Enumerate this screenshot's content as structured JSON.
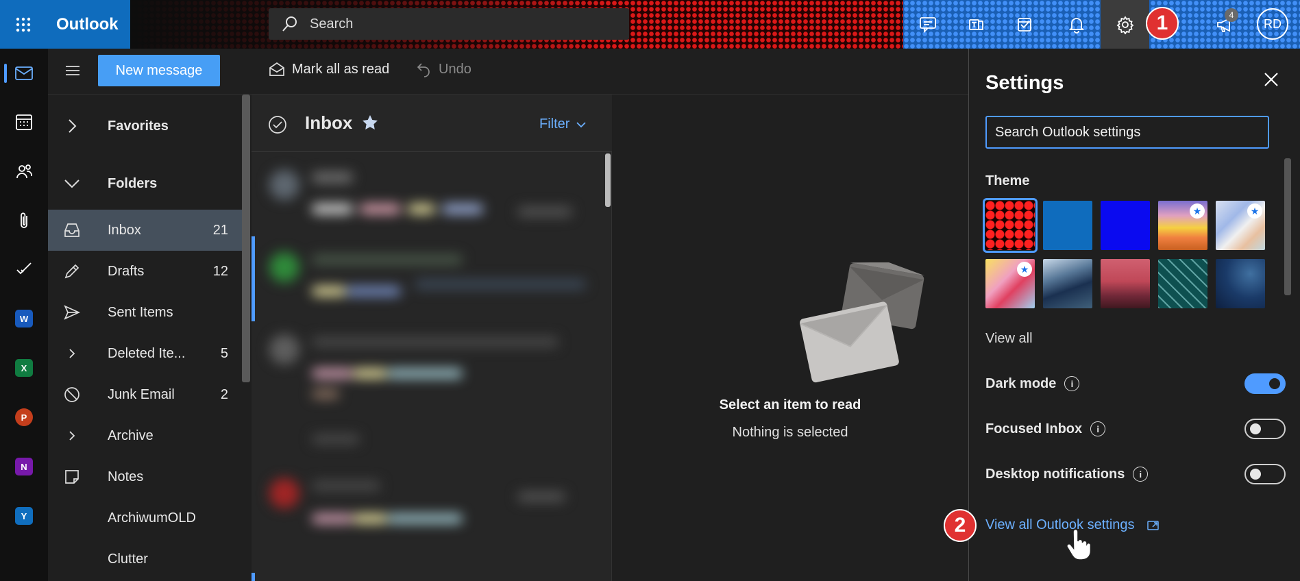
{
  "topbar": {
    "app_name": "Outlook",
    "search_placeholder": "Search",
    "avatar_initials": "RD",
    "notification_count": "4",
    "icons": [
      "app-launcher-icon",
      "search-icon",
      "chat-icon",
      "teams-icon",
      "todo-icon",
      "bell-icon",
      "gear-icon",
      "megaphone-icon"
    ]
  },
  "markers": {
    "step1": "1",
    "step2": "2"
  },
  "rail": [
    "mail-icon",
    "calendar-icon",
    "people-icon",
    "attachment-icon",
    "todo-icon",
    "word-icon",
    "excel-icon",
    "powerpoint-icon",
    "onenote-icon",
    "yammer-icon"
  ],
  "commandbar": {
    "new_message": "New message",
    "mark_all_read": "Mark all as read",
    "undo": "Undo"
  },
  "folders": {
    "favorites": "Favorites",
    "folders": "Folders",
    "items": [
      {
        "label": "Inbox",
        "count": "21"
      },
      {
        "label": "Drafts",
        "count": "12"
      },
      {
        "label": "Sent Items",
        "count": ""
      },
      {
        "label": "Deleted Ite...",
        "count": "5"
      },
      {
        "label": "Junk Email",
        "count": "2"
      },
      {
        "label": "Archive",
        "count": ""
      },
      {
        "label": "Notes",
        "count": ""
      },
      {
        "label": "ArchiwumOLD",
        "count": ""
      },
      {
        "label": "Clutter",
        "count": ""
      }
    ]
  },
  "list": {
    "title": "Inbox",
    "filter": "Filter"
  },
  "reading": {
    "title": "Select an item to read",
    "subtitle": "Nothing is selected"
  },
  "settings": {
    "title": "Settings",
    "search_value": "Search Outlook settings",
    "theme_label": "Theme",
    "view_all": "View all",
    "toggles": [
      {
        "label": "Dark mode",
        "on": true
      },
      {
        "label": "Focused Inbox",
        "on": false
      },
      {
        "label": "Desktop notifications",
        "on": false
      }
    ],
    "view_all_settings": "View all Outlook settings"
  },
  "colors": {
    "accent": "#479ef5",
    "brand": "#0f6cbd",
    "marker": "#e03131"
  }
}
